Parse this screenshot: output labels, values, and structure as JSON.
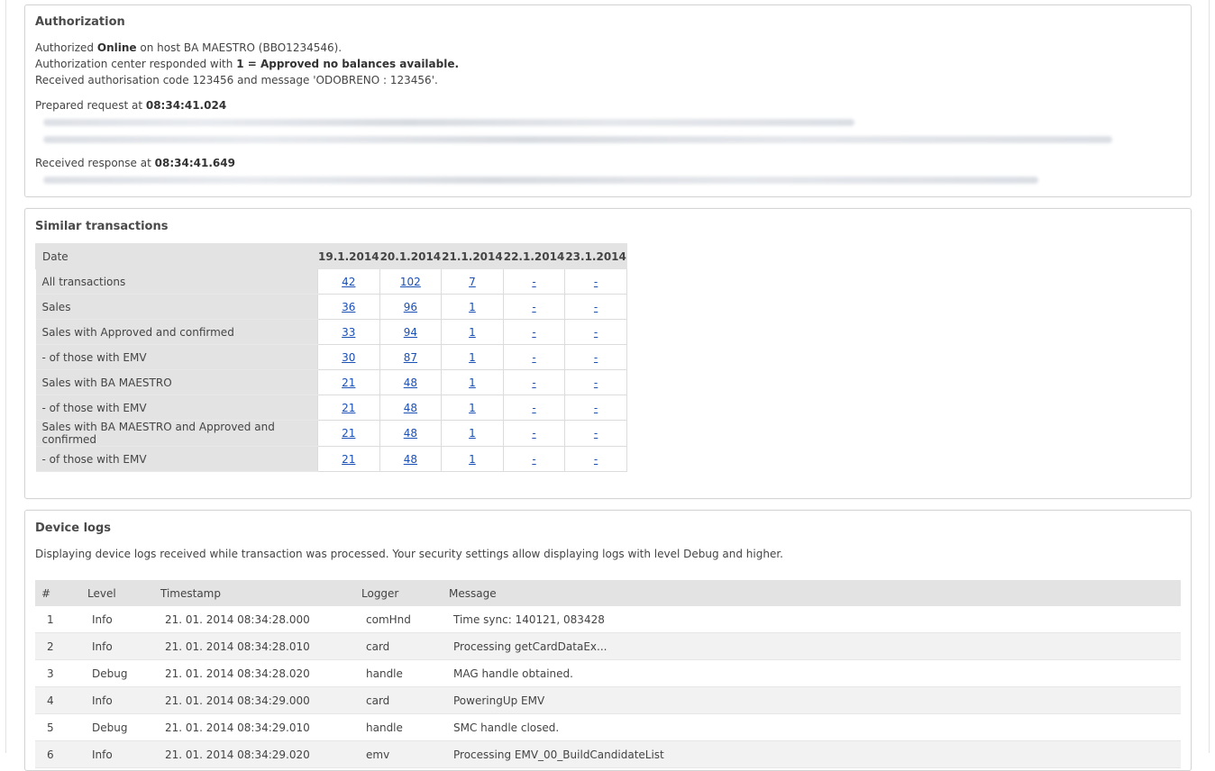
{
  "authorization": {
    "title": "Authorization",
    "line1_prefix": "Authorized",
    "line1_mode": "Online",
    "line1_mid": "on host",
    "line1_host": "BA MAESTRO (BBO1234546).",
    "line2_prefix": "Authorization center responded with",
    "line2_code": "1 = Approved no balances available.",
    "line3": "Received authorisation code 123456 and message 'ODOBRENO : 123456'.",
    "prepared_prefix": "Prepared request at",
    "prepared_time": "08:34:41.024",
    "received_prefix": "Received response at",
    "received_time": "08:34:41.649"
  },
  "similar": {
    "title": "Similar transactions",
    "header_label": "Date",
    "dates": [
      "19.1.2014",
      "20.1.2014",
      "21.1.2014",
      "22.1.2014",
      "23.1.2014"
    ],
    "rows": [
      {
        "label": "All transactions",
        "values": [
          "42",
          "102",
          "7",
          "-",
          "-"
        ]
      },
      {
        "label": "Sales",
        "values": [
          "36",
          "96",
          "1",
          "-",
          "-"
        ]
      },
      {
        "label": "Sales with Approved and confirmed",
        "values": [
          "33",
          "94",
          "1",
          "-",
          "-"
        ]
      },
      {
        "label": "- of those with EMV",
        "values": [
          "30",
          "87",
          "1",
          "-",
          "-"
        ]
      },
      {
        "label": "Sales with BA MAESTRO",
        "values": [
          "21",
          "48",
          "1",
          "-",
          "-"
        ]
      },
      {
        "label": "- of those with EMV",
        "values": [
          "21",
          "48",
          "1",
          "-",
          "-"
        ]
      },
      {
        "label": "Sales with BA MAESTRO and Approved and confirmed",
        "values": [
          "21",
          "48",
          "1",
          "-",
          "-"
        ]
      },
      {
        "label": "- of those with EMV",
        "values": [
          "21",
          "48",
          "1",
          "-",
          "-"
        ]
      }
    ]
  },
  "logs": {
    "title": "Device logs",
    "description": "Displaying device logs received while transaction was processed. Your security settings allow displaying logs with level Debug and higher.",
    "columns": [
      "#",
      "Level",
      "Timestamp",
      "Logger",
      "Message"
    ],
    "rows": [
      {
        "num": "1",
        "level": "Info",
        "timestamp": "21. 01. 2014 08:34:28.000",
        "logger": "comHnd",
        "message": "Time sync: 140121, 083428"
      },
      {
        "num": "2",
        "level": "Info",
        "timestamp": "21. 01. 2014 08:34:28.010",
        "logger": "card",
        "message": "Processing getCardDataEx..."
      },
      {
        "num": "3",
        "level": "Debug",
        "timestamp": "21. 01. 2014 08:34:28.020",
        "logger": "handle",
        "message": "MAG handle obtained."
      },
      {
        "num": "4",
        "level": "Info",
        "timestamp": "21. 01. 2014 08:34:29.000",
        "logger": "card",
        "message": "PoweringUp EMV"
      },
      {
        "num": "5",
        "level": "Debug",
        "timestamp": "21. 01. 2014 08:34:29.010",
        "logger": "handle",
        "message": "SMC handle closed."
      },
      {
        "num": "6",
        "level": "Info",
        "timestamp": "21. 01. 2014 08:34:29.020",
        "logger": "emv",
        "message": "Processing EMV_00_BuildCandidateList"
      }
    ]
  }
}
